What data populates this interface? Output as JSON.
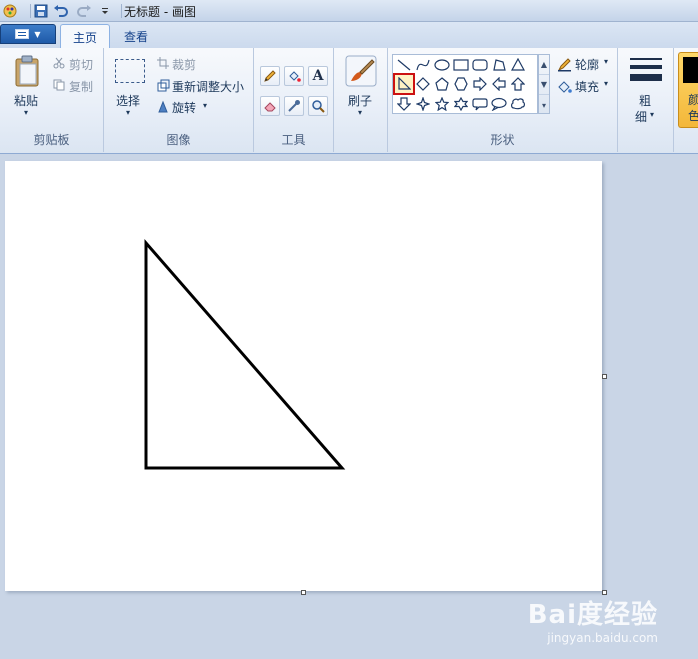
{
  "window": {
    "title": "无标题 - 画图"
  },
  "tabs": [
    {
      "label": "主页",
      "active": true
    },
    {
      "label": "查看",
      "active": false
    }
  ],
  "ribbon": {
    "clipboard": {
      "group_label": "剪贴板",
      "paste": "粘贴",
      "cut": "剪切",
      "copy": "复制"
    },
    "image": {
      "group_label": "图像",
      "select": "选择",
      "crop": "裁剪",
      "resize": "重新调整大小",
      "rotate": "旋转"
    },
    "tools": {
      "group_label": "工具",
      "text_glyph": "A"
    },
    "brushes": {
      "label": "刷子"
    },
    "shapes": {
      "group_label": "形状",
      "outline": "轮廓",
      "fill": "填充",
      "selected_shape": "right-triangle"
    },
    "size": {
      "label_line1": "粗",
      "label_line2": "细"
    },
    "colors": {
      "label_line1": "颜",
      "label_line2": "色"
    }
  },
  "watermark": {
    "main": "Bai度经验",
    "sub": "jingyan.baidu.com"
  },
  "colors": {
    "accent": "#cc1111",
    "ribbon_bg": "#e9eff8",
    "workspace_bg": "#c9d5e6",
    "app_button": "#2a68b8"
  }
}
